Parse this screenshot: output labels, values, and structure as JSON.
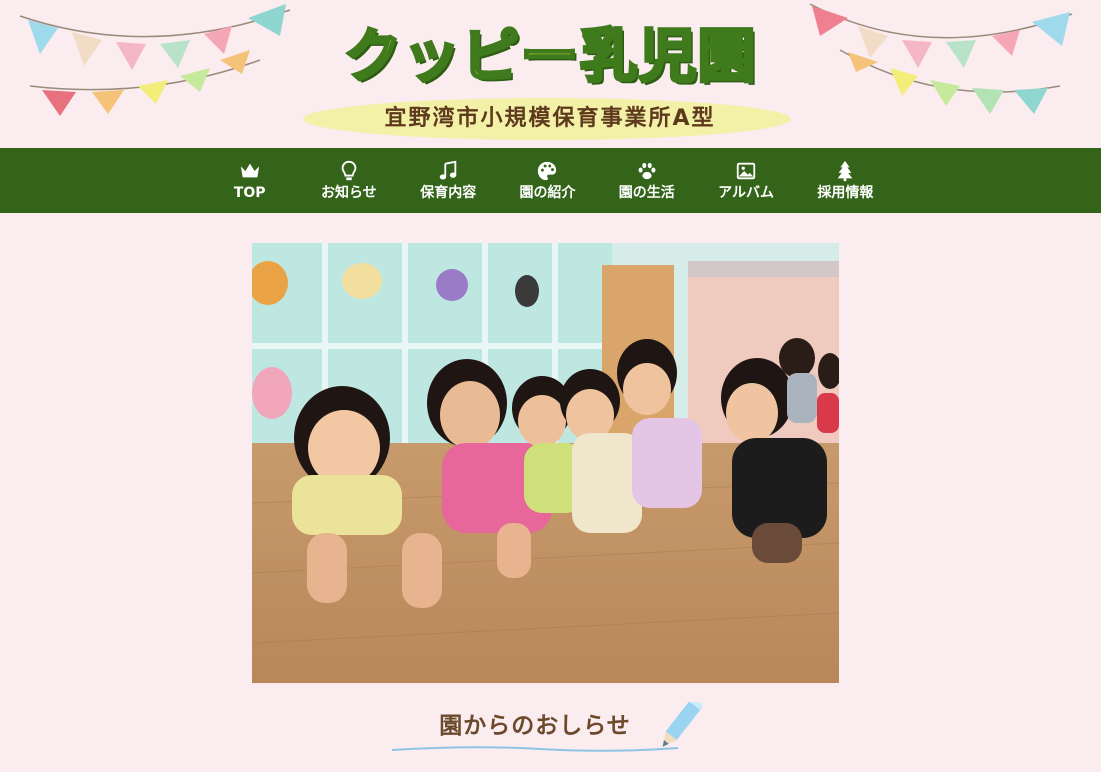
{
  "header": {
    "title": "クッピー乳児園",
    "subtitle": "宜野湾市小規模保育事業所A型"
  },
  "nav": {
    "items": [
      {
        "label": "TOP",
        "icon": "crown-icon"
      },
      {
        "label": "お知らせ",
        "icon": "lightbulb-icon"
      },
      {
        "label": "保育内容",
        "icon": "music-note-icon"
      },
      {
        "label": "園の紹介",
        "icon": "palette-icon"
      },
      {
        "label": "園の生活",
        "icon": "paw-icon"
      },
      {
        "label": "アルバム",
        "icon": "image-icon"
      },
      {
        "label": "採用情報",
        "icon": "tree-icon"
      }
    ]
  },
  "news": {
    "heading": "園からのおしらせ"
  },
  "colors": {
    "background": "#fbecef",
    "nav_bg": "#33641a",
    "logo_yellow": "#f2ec3a",
    "logo_green": "#3f7a1c",
    "subtitle_brown": "#5e3a1c"
  }
}
